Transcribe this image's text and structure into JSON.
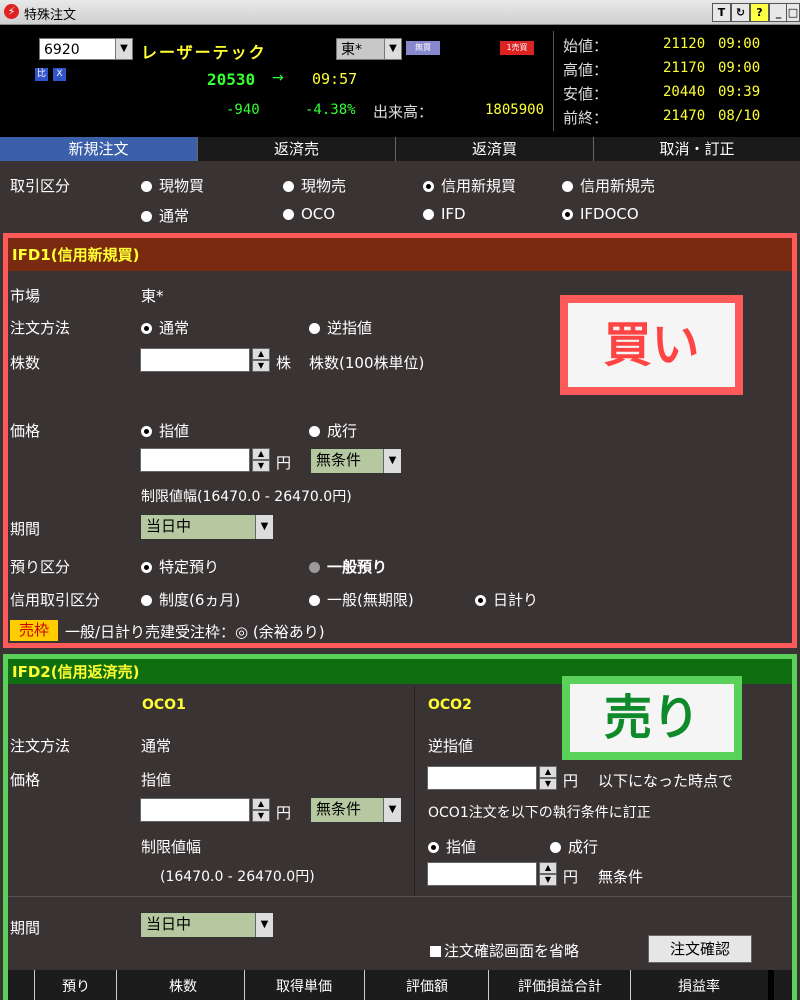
{
  "window": {
    "title": "特殊注文",
    "buttons": [
      "T",
      "↻",
      "?",
      "_",
      "□"
    ]
  },
  "header": {
    "code": "6920",
    "company": "レーザーテック",
    "market": "東*",
    "badge_small": "無貫",
    "badge_red": "1売買",
    "icon_a": "比",
    "icon_b": "X",
    "current_price": "20530",
    "arrow": "→",
    "time": "09:57",
    "change": "-940",
    "change_pct": "-4.38%",
    "volume_label": "出来高：",
    "volume": "1805900",
    "quotes": [
      {
        "label": "始値：",
        "value": "21120",
        "time": "09:00"
      },
      {
        "label": "高値：",
        "value": "21170",
        "time": "09:00"
      },
      {
        "label": "安値：",
        "value": "20440",
        "time": "09:39"
      },
      {
        "label": "前終：",
        "value": "21470",
        "time": "08/10"
      }
    ]
  },
  "tabs": [
    "新規注文",
    "返済売",
    "返済買",
    "取消・訂正"
  ],
  "trade_type": {
    "label": "取引区分",
    "row1": [
      "現物買",
      "現物売",
      "信用新規買",
      "信用新規売"
    ],
    "row2": [
      "通常",
      "OCO",
      "IFD",
      "IFDOCO"
    ]
  },
  "ifd1": {
    "title": "IFD1(信用新規買)",
    "market_label": "市場",
    "market_value": "東*",
    "method_label": "注文方法",
    "method_opts": [
      "通常",
      "逆指値"
    ],
    "qty_label": "株数",
    "qty_unit": "株",
    "qty_note": "株数(100株単位)",
    "price_label": "価格",
    "price_opts": [
      "指値",
      "成行"
    ],
    "price_unit": "円",
    "condition": "無条件",
    "limit_range": "制限値幅(16470.0 - 26470.0円)",
    "period_label": "期間",
    "period_value": "当日中",
    "deposit_label": "預り区分",
    "deposit_opts": [
      "特定預り",
      "一般預り"
    ],
    "credit_label": "信用取引区分",
    "credit_opts": [
      "制度(6ヵ月)",
      "一般(無期限)",
      "日計り"
    ],
    "waku_badge": "売枠",
    "waku_text": "一般/日計り売建受注枠：◎ (余裕あり)",
    "overlay": "買い"
  },
  "ifd2": {
    "title": "IFD2(信用返済売)",
    "oco1": "OCO1",
    "oco2": "OCO2",
    "method_label": "注文方法",
    "method_value": "通常",
    "price_label": "価格",
    "price_value": "指値",
    "price_unit": "円",
    "condition": "無条件",
    "limit_label": "制限値幅",
    "limit_value": "(16470.0 - 26470.0円)",
    "oco2_method": "逆指値",
    "oco2_trigger": "以下になった時点で",
    "oco2_note": "OCO1注文を以下の執行条件に訂正",
    "oco2_opts": [
      "指値",
      "成行"
    ],
    "oco2_unit": "円",
    "oco2_condition": "無条件",
    "period_label": "期間",
    "period_value": "当日中",
    "skip_confirm": "注文確認画面を省略",
    "confirm_button": "注文確認",
    "overlay": "売り"
  },
  "table_headers": [
    "預り",
    "株数",
    "取得単価",
    "評価額",
    "評価損益合計",
    "損益率"
  ],
  "colors": {
    "red_frame": "#ff5a5a",
    "green_frame": "#5ad25a",
    "ifd1_header": "#7a2a10",
    "ifd2_header": "#0f6e0f",
    "yellow_text": "#ffff33",
    "green_text": "#33ff33"
  }
}
